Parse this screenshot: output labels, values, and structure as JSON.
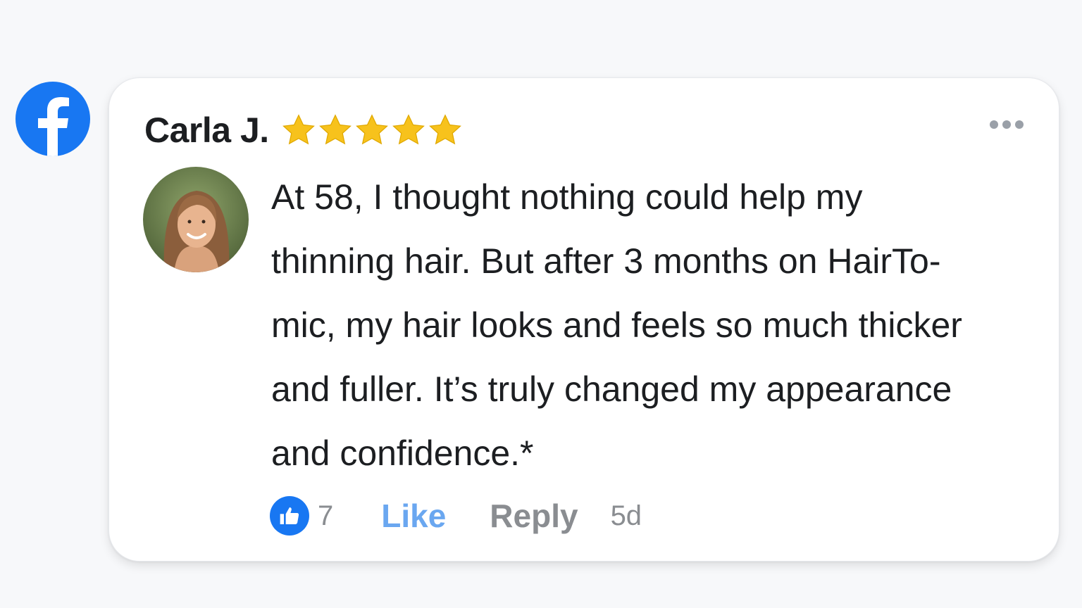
{
  "brand": {
    "logo_icon": "facebook-f-icon",
    "color": "#1877f2"
  },
  "comment": {
    "author": "Carla J.",
    "rating": 5,
    "rating_max": 5,
    "star_color": "#f7c21c",
    "avatar_icon": "user-avatar-photo",
    "text_lines": [
      "At 58, I thought nothing could help my",
      "thinning hair. But after 3 months on HairTo-",
      "mic, my hair looks and feels so much thicker",
      "and fuller. It’s truly changed my appearance",
      "and confidence.*"
    ],
    "more_icon": "more-horizontal-icon"
  },
  "actions": {
    "like_icon": "thumbs-up-icon",
    "like_count": "7",
    "like_label": "Like",
    "reply_label": "Reply",
    "timestamp": "5d"
  }
}
